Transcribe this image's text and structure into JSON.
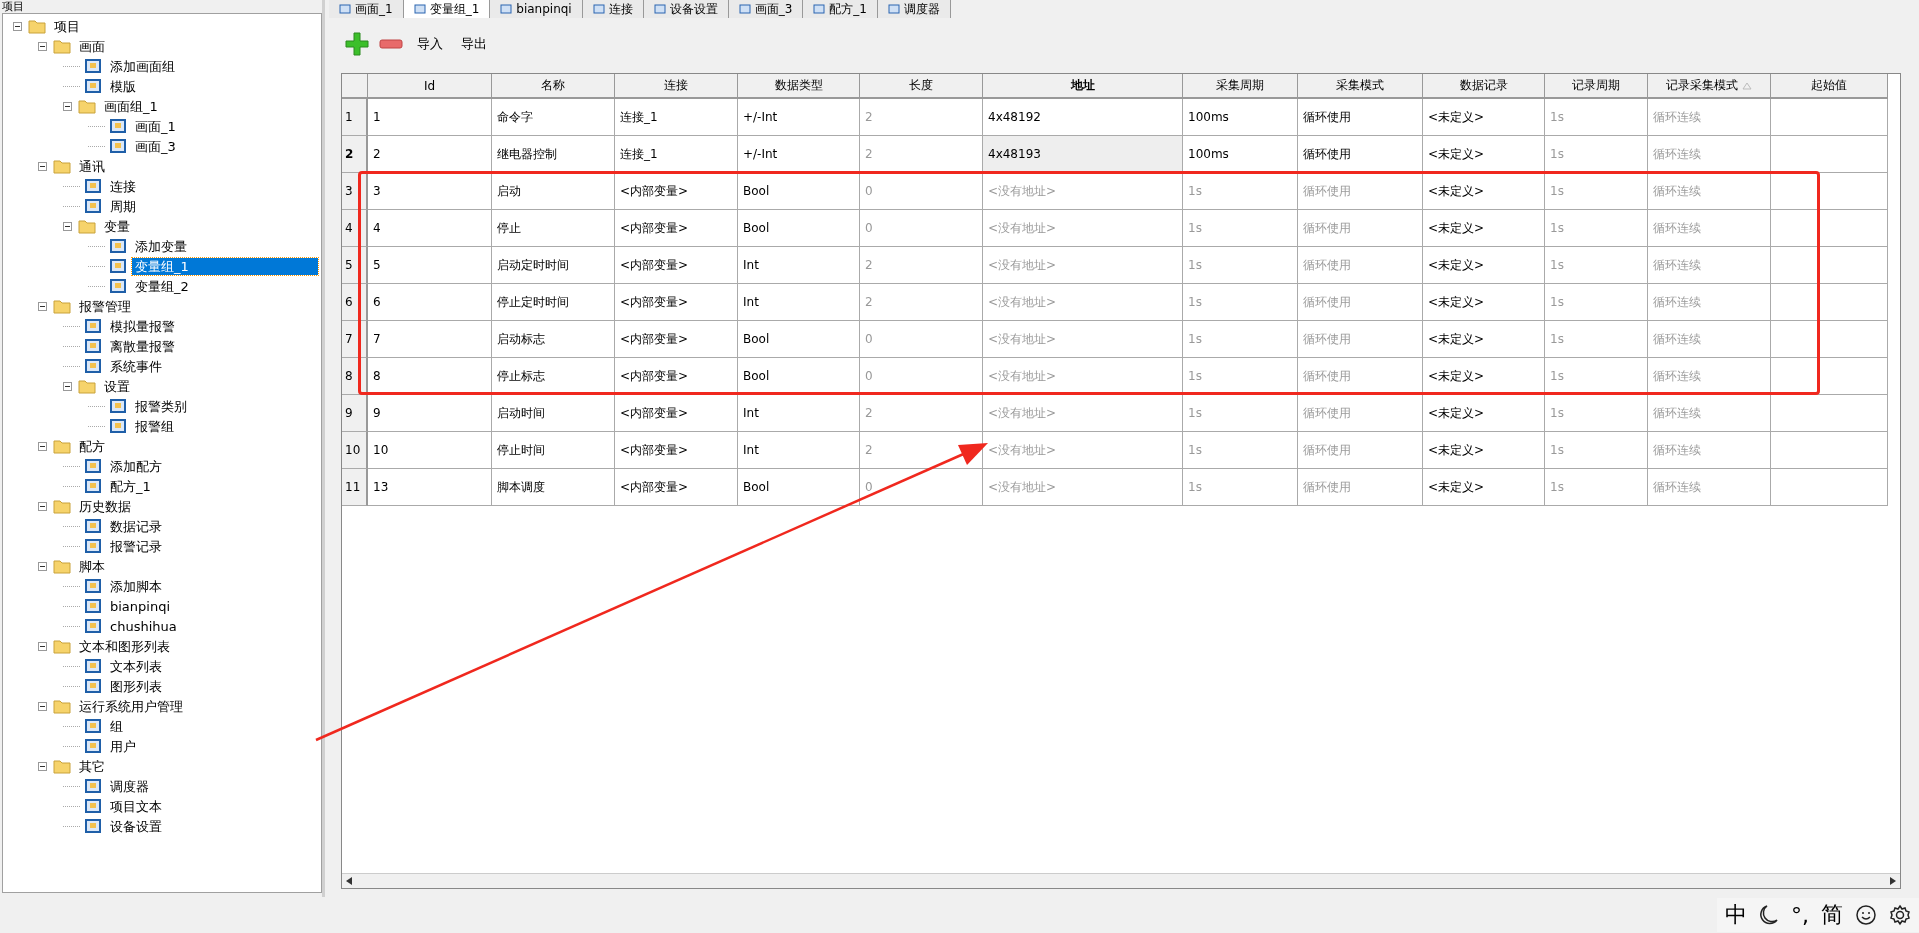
{
  "project_panel": {
    "title": "项目",
    "tree": [
      {
        "label": "项目",
        "expanded": true,
        "selected": false,
        "children": [
          {
            "label": "画面",
            "expanded": true,
            "selected": false,
            "children": [
              {
                "label": "添加画面组",
                "selected": false
              },
              {
                "label": "模版",
                "selected": false
              },
              {
                "label": "画面组_1",
                "expanded": true,
                "selected": false,
                "children": [
                  {
                    "label": "画面_1",
                    "selected": false
                  },
                  {
                    "label": "画面_3",
                    "selected": false
                  }
                ]
              }
            ]
          },
          {
            "label": "通讯",
            "expanded": true,
            "selected": false,
            "children": [
              {
                "label": "连接",
                "selected": false
              },
              {
                "label": "周期",
                "selected": false
              },
              {
                "label": "变量",
                "expanded": true,
                "selected": false,
                "children": [
                  {
                    "label": "添加变量",
                    "selected": false
                  },
                  {
                    "label": "变量组_1",
                    "selected": true
                  },
                  {
                    "label": "变量组_2",
                    "selected": false
                  }
                ]
              }
            ]
          },
          {
            "label": "报警管理",
            "expanded": true,
            "selected": false,
            "children": [
              {
                "label": "模拟量报警",
                "selected": false
              },
              {
                "label": "离散量报警",
                "selected": false
              },
              {
                "label": "系统事件",
                "selected": false
              },
              {
                "label": "设置",
                "expanded": true,
                "selected": false,
                "children": [
                  {
                    "label": "报警类别",
                    "selected": false
                  },
                  {
                    "label": "报警组",
                    "selected": false
                  }
                ]
              }
            ]
          },
          {
            "label": "配方",
            "expanded": true,
            "selected": false,
            "children": [
              {
                "label": "添加配方",
                "selected": false
              },
              {
                "label": "配方_1",
                "selected": false
              }
            ]
          },
          {
            "label": "历史数据",
            "expanded": true,
            "selected": false,
            "children": [
              {
                "label": "数据记录",
                "selected": false
              },
              {
                "label": "报警记录",
                "selected": false
              }
            ]
          },
          {
            "label": "脚本",
            "expanded": true,
            "selected": false,
            "children": [
              {
                "label": "添加脚本",
                "selected": false
              },
              {
                "label": "bianpinqi",
                "selected": false
              },
              {
                "label": "chushihua",
                "selected": false
              }
            ]
          },
          {
            "label": "文本和图形列表",
            "expanded": true,
            "selected": false,
            "children": [
              {
                "label": "文本列表",
                "selected": false
              },
              {
                "label": "图形列表",
                "selected": false
              }
            ]
          },
          {
            "label": "运行系统用户管理",
            "expanded": true,
            "selected": false,
            "children": [
              {
                "label": "组",
                "selected": false
              },
              {
                "label": "用户",
                "selected": false
              }
            ]
          },
          {
            "label": "其它",
            "expanded": true,
            "selected": false,
            "children": [
              {
                "label": "调度器",
                "selected": false
              },
              {
                "label": "项目文本",
                "selected": false
              },
              {
                "label": "设备设置",
                "selected": false
              }
            ]
          }
        ]
      }
    ]
  },
  "tabs": [
    {
      "label": "画面_1",
      "selected": false
    },
    {
      "label": "变量组_1",
      "selected": true
    },
    {
      "label": "bianpinqi",
      "selected": false
    },
    {
      "label": "连接",
      "selected": false
    },
    {
      "label": "设备设置",
      "selected": false
    },
    {
      "label": "画面_3",
      "selected": false
    },
    {
      "label": "配方_1",
      "selected": false
    },
    {
      "label": "调度器",
      "selected": false
    }
  ],
  "toolbar": {
    "import": "导入",
    "export": "导出"
  },
  "table": {
    "columns": [
      {
        "label": "Id",
        "bold": false
      },
      {
        "label": "名称",
        "bold": false
      },
      {
        "label": "连接",
        "bold": false
      },
      {
        "label": "数据类型",
        "bold": false
      },
      {
        "label": "长度",
        "bold": false
      },
      {
        "label": "地址",
        "bold": true
      },
      {
        "label": "采集周期",
        "bold": false
      },
      {
        "label": "采集模式",
        "bold": false
      },
      {
        "label": "数据记录",
        "bold": false
      },
      {
        "label": "记录周期",
        "bold": false
      },
      {
        "label": "记录采集模式",
        "bold": false,
        "sorted": true
      },
      {
        "label": "起始值",
        "bold": false
      }
    ],
    "rows": [
      {
        "header": "1",
        "selected": false,
        "cells": [
          {
            "text": "1",
            "dimmed": false
          },
          {
            "text": "命令字",
            "dimmed": false
          },
          {
            "text": "连接_1",
            "dimmed": false
          },
          {
            "text": "+/-Int",
            "dimmed": false
          },
          {
            "text": "2",
            "dimmed": true
          },
          {
            "text": "4x48192",
            "dimmed": false
          },
          {
            "text": "100ms",
            "dimmed": false
          },
          {
            "text": "循环使用",
            "dimmed": false
          },
          {
            "text": "<未定义>",
            "dimmed": false
          },
          {
            "text": "1s",
            "dimmed": true
          },
          {
            "text": "循环连续",
            "dimmed": true
          }
        ]
      },
      {
        "header": "2",
        "selected": true,
        "cells": [
          {
            "text": "2",
            "dimmed": false
          },
          {
            "text": "继电器控制",
            "dimmed": false
          },
          {
            "text": "连接_1",
            "dimmed": false
          },
          {
            "text": "+/-Int",
            "dimmed": false
          },
          {
            "text": "2",
            "dimmed": true
          },
          {
            "text": "4x48193",
            "dimmed": false
          },
          {
            "text": "100ms",
            "dimmed": false
          },
          {
            "text": "循环使用",
            "dimmed": false
          },
          {
            "text": "<未定义>",
            "dimmed": false
          },
          {
            "text": "1s",
            "dimmed": true
          },
          {
            "text": "循环连续",
            "dimmed": true
          }
        ]
      },
      {
        "header": "3",
        "selected": false,
        "cells": [
          {
            "text": "3",
            "dimmed": false
          },
          {
            "text": "启动",
            "dimmed": false
          },
          {
            "text": "<内部变量>",
            "dimmed": false
          },
          {
            "text": "Bool",
            "dimmed": false
          },
          {
            "text": "0",
            "dimmed": true
          },
          {
            "text": "<没有地址>",
            "dimmed": true
          },
          {
            "text": "1s",
            "dimmed": true
          },
          {
            "text": "循环使用",
            "dimmed": true
          },
          {
            "text": "<未定义>",
            "dimmed": false
          },
          {
            "text": "1s",
            "dimmed": true
          },
          {
            "text": "循环连续",
            "dimmed": true
          }
        ]
      },
      {
        "header": "4",
        "selected": false,
        "cells": [
          {
            "text": "4",
            "dimmed": false
          },
          {
            "text": "停止",
            "dimmed": false
          },
          {
            "text": "<内部变量>",
            "dimmed": false
          },
          {
            "text": "Bool",
            "dimmed": false
          },
          {
            "text": "0",
            "dimmed": true
          },
          {
            "text": "<没有地址>",
            "dimmed": true
          },
          {
            "text": "1s",
            "dimmed": true
          },
          {
            "text": "循环使用",
            "dimmed": true
          },
          {
            "text": "<未定义>",
            "dimmed": false
          },
          {
            "text": "1s",
            "dimmed": true
          },
          {
            "text": "循环连续",
            "dimmed": true
          }
        ]
      },
      {
        "header": "5",
        "selected": false,
        "cells": [
          {
            "text": "5",
            "dimmed": false
          },
          {
            "text": "启动定时时间",
            "dimmed": false
          },
          {
            "text": "<内部变量>",
            "dimmed": false
          },
          {
            "text": "Int",
            "dimmed": false
          },
          {
            "text": "2",
            "dimmed": true
          },
          {
            "text": "<没有地址>",
            "dimmed": true
          },
          {
            "text": "1s",
            "dimmed": true
          },
          {
            "text": "循环使用",
            "dimmed": true
          },
          {
            "text": "<未定义>",
            "dimmed": false
          },
          {
            "text": "1s",
            "dimmed": true
          },
          {
            "text": "循环连续",
            "dimmed": true
          }
        ]
      },
      {
        "header": "6",
        "selected": false,
        "cells": [
          {
            "text": "6",
            "dimmed": false
          },
          {
            "text": "停止定时时间",
            "dimmed": false
          },
          {
            "text": "<内部变量>",
            "dimmed": false
          },
          {
            "text": "Int",
            "dimmed": false
          },
          {
            "text": "2",
            "dimmed": true
          },
          {
            "text": "<没有地址>",
            "dimmed": true
          },
          {
            "text": "1s",
            "dimmed": true
          },
          {
            "text": "循环使用",
            "dimmed": true
          },
          {
            "text": "<未定义>",
            "dimmed": false
          },
          {
            "text": "1s",
            "dimmed": true
          },
          {
            "text": "循环连续",
            "dimmed": true
          }
        ]
      },
      {
        "header": "7",
        "selected": false,
        "cells": [
          {
            "text": "7",
            "dimmed": false
          },
          {
            "text": "启动标志",
            "dimmed": false
          },
          {
            "text": "<内部变量>",
            "dimmed": false
          },
          {
            "text": "Bool",
            "dimmed": false
          },
          {
            "text": "0",
            "dimmed": true
          },
          {
            "text": "<没有地址>",
            "dimmed": true
          },
          {
            "text": "1s",
            "dimmed": true
          },
          {
            "text": "循环使用",
            "dimmed": true
          },
          {
            "text": "<未定义>",
            "dimmed": false
          },
          {
            "text": "1s",
            "dimmed": true
          },
          {
            "text": "循环连续",
            "dimmed": true
          }
        ]
      },
      {
        "header": "8",
        "selected": false,
        "cells": [
          {
            "text": "8",
            "dimmed": false
          },
          {
            "text": "停止标志",
            "dimmed": false
          },
          {
            "text": "<内部变量>",
            "dimmed": false
          },
          {
            "text": "Bool",
            "dimmed": false
          },
          {
            "text": "0",
            "dimmed": true
          },
          {
            "text": "<没有地址>",
            "dimmed": true
          },
          {
            "text": "1s",
            "dimmed": true
          },
          {
            "text": "循环使用",
            "dimmed": true
          },
          {
            "text": "<未定义>",
            "dimmed": false
          },
          {
            "text": "1s",
            "dimmed": true
          },
          {
            "text": "循环连续",
            "dimmed": true
          }
        ]
      },
      {
        "header": "9",
        "selected": false,
        "cells": [
          {
            "text": "9",
            "dimmed": false
          },
          {
            "text": "启动时间",
            "dimmed": false
          },
          {
            "text": "<内部变量>",
            "dimmed": false
          },
          {
            "text": "Int",
            "dimmed": false
          },
          {
            "text": "2",
            "dimmed": true
          },
          {
            "text": "<没有地址>",
            "dimmed": true
          },
          {
            "text": "1s",
            "dimmed": true
          },
          {
            "text": "循环使用",
            "dimmed": true
          },
          {
            "text": "<未定义>",
            "dimmed": false
          },
          {
            "text": "1s",
            "dimmed": true
          },
          {
            "text": "循环连续",
            "dimmed": true
          }
        ]
      },
      {
        "header": "10",
        "selected": false,
        "cells": [
          {
            "text": "10",
            "dimmed": false
          },
          {
            "text": "停止时间",
            "dimmed": false
          },
          {
            "text": "<内部变量>",
            "dimmed": false
          },
          {
            "text": "Int",
            "dimmed": false
          },
          {
            "text": "2",
            "dimmed": true
          },
          {
            "text": "<没有地址>",
            "dimmed": true
          },
          {
            "text": "1s",
            "dimmed": true
          },
          {
            "text": "循环使用",
            "dimmed": true
          },
          {
            "text": "<未定义>",
            "dimmed": false
          },
          {
            "text": "1s",
            "dimmed": true
          },
          {
            "text": "循环连续",
            "dimmed": true
          }
        ]
      },
      {
        "header": "11",
        "selected": false,
        "cells": [
          {
            "text": "13",
            "dimmed": false
          },
          {
            "text": "脚本调度",
            "dimmed": false
          },
          {
            "text": "<内部变量>",
            "dimmed": false
          },
          {
            "text": "Bool",
            "dimmed": false
          },
          {
            "text": "0",
            "dimmed": true
          },
          {
            "text": "<没有地址>",
            "dimmed": true
          },
          {
            "text": "1s",
            "dimmed": true
          },
          {
            "text": "循环使用",
            "dimmed": true
          },
          {
            "text": "<未定义>",
            "dimmed": false
          },
          {
            "text": "1s",
            "dimmed": true
          },
          {
            "text": "循环连续",
            "dimmed": true
          }
        ]
      }
    ]
  },
  "ime_bar": {
    "mode": "中",
    "punct": "°,",
    "script": "简"
  }
}
